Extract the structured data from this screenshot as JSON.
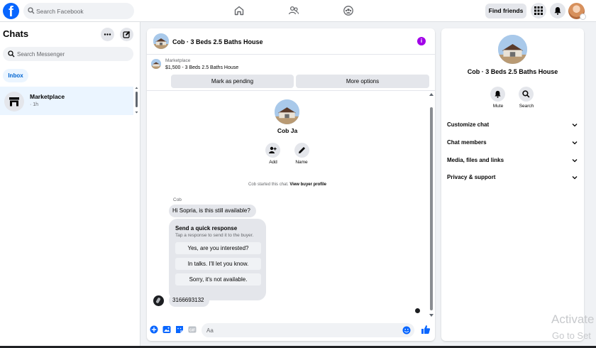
{
  "topbar": {
    "search_placeholder": "Search Facebook",
    "find_friends": "Find friends",
    "logo_letter": "f",
    "brand_color": "#0866ff"
  },
  "left": {
    "title": "Chats",
    "search_placeholder": "Search Messenger",
    "filter": "Inbox",
    "conversations": [
      {
        "name": "Marketplace",
        "time": "· 1h"
      }
    ]
  },
  "chat": {
    "title": "Cob · 3 Beds 2.5 Baths House",
    "info_icon_label": "i",
    "marketplace": {
      "label": "Marketplace",
      "listing": "$1,500 - 3 Beds 2.5 Baths House",
      "btn_pending": "Mark as pending",
      "btn_more": "More options"
    },
    "profile_name": "Cob Ja",
    "actions": [
      {
        "label": "Add",
        "icon": "add-person-icon"
      },
      {
        "label": "Name",
        "icon": "pencil-icon"
      }
    ],
    "started_text": "Cob started this chat.",
    "started_link": "View buyer profile",
    "sender": "Cob",
    "message1": "Hi Sopria, is this still available?",
    "quick": {
      "title": "Send a quick response",
      "subtitle": "Tap a response to send it to the buyer.",
      "options": [
        "Yes, are you interested?",
        "In talks. I'll let you know.",
        "Sorry, it's not available."
      ]
    },
    "message2": "3166693132",
    "composer_placeholder": "Aa",
    "accent_color": "#0866ff"
  },
  "right": {
    "title": "Cob · 3 Beds 2.5 Baths House",
    "actions": [
      {
        "label": "Mute",
        "icon": "bell-icon"
      },
      {
        "label": "Search",
        "icon": "search-icon"
      }
    ],
    "sections": [
      "Customize chat",
      "Chat members",
      "Media, files and links",
      "Privacy & support"
    ]
  },
  "watermark": {
    "line1": "Activate",
    "line2": "Go to Set"
  }
}
